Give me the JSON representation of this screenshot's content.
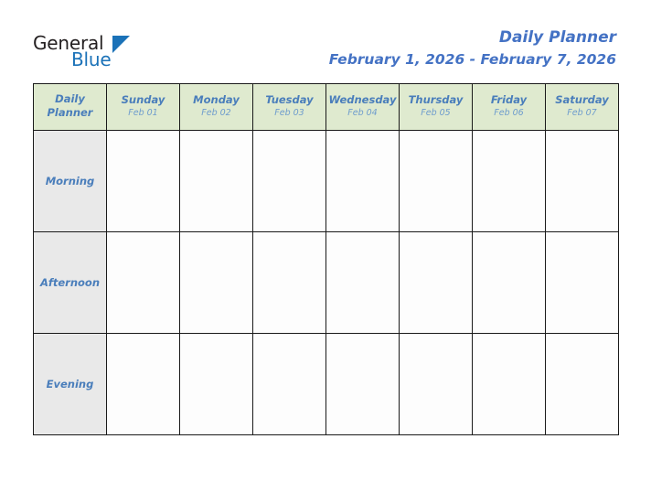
{
  "logo": {
    "word_one": "General",
    "word_two": "Blue",
    "triangle_icon": "triangle-icon",
    "word_one_color": "#231f20",
    "word_two_color": "#1b72b8"
  },
  "header": {
    "title": "Daily Planner",
    "date_range": "February 1, 2026 - February 7, 2026",
    "title_color": "#4472c4"
  },
  "table": {
    "corner_label_line1": "Daily",
    "corner_label_line2": "Planner",
    "header_bg": "#dfeacf",
    "label_bg": "#e9e9e9",
    "cell_bg": "#fdfdfd",
    "border_color": "#1a1a1a",
    "accent_text": "#4a7ebb",
    "columns": [
      {
        "day": "Sunday",
        "date": "Feb 01"
      },
      {
        "day": "Monday",
        "date": "Feb 02"
      },
      {
        "day": "Tuesday",
        "date": "Feb 03"
      },
      {
        "day": "Wednesday",
        "date": "Feb 04"
      },
      {
        "day": "Thursday",
        "date": "Feb 05"
      },
      {
        "day": "Friday",
        "date": "Feb 06"
      },
      {
        "day": "Saturday",
        "date": "Feb 07"
      }
    ],
    "rows": [
      {
        "label": "Morning",
        "cells": [
          "",
          "",
          "",
          "",
          "",
          "",
          ""
        ]
      },
      {
        "label": "Afternoon",
        "cells": [
          "",
          "",
          "",
          "",
          "",
          "",
          ""
        ]
      },
      {
        "label": "Evening",
        "cells": [
          "",
          "",
          "",
          "",
          "",
          "",
          ""
        ]
      }
    ]
  }
}
